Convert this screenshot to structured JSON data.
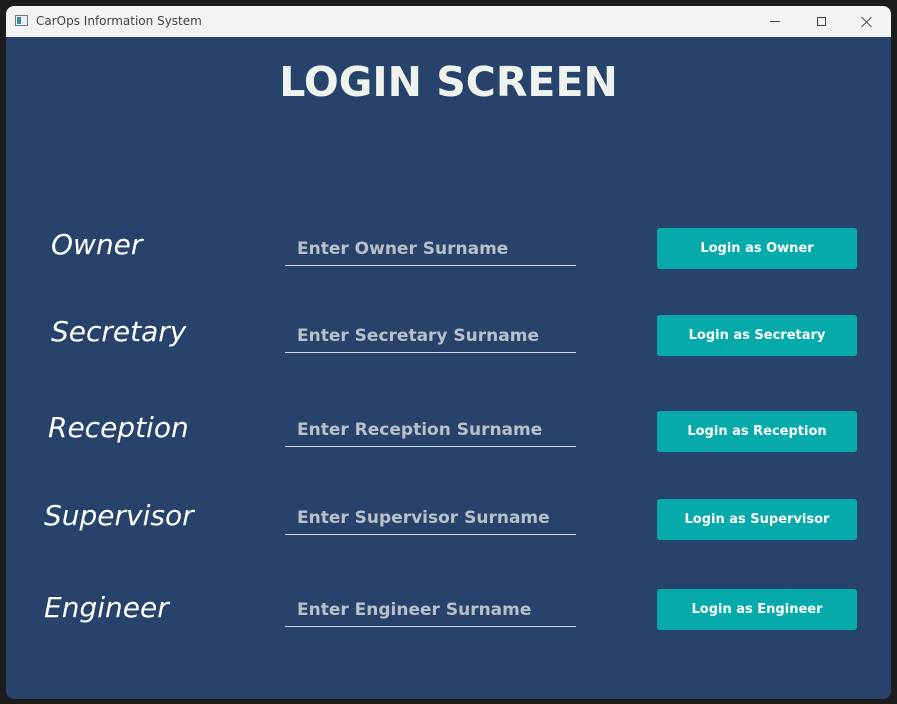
{
  "window": {
    "title": "CarOps Information System"
  },
  "heading": "LOGIN SCREEN",
  "roles": [
    {
      "label": "Owner",
      "placeholder": "Enter Owner Surname",
      "value": "",
      "button": "Login as Owner"
    },
    {
      "label": "Secretary",
      "placeholder": "Enter Secretary Surname",
      "value": "",
      "button": "Login as Secretary"
    },
    {
      "label": "Reception",
      "placeholder": "Enter Reception Surname",
      "value": "",
      "button": "Login as Reception"
    },
    {
      "label": "Supervisor",
      "placeholder": "Enter Supervisor Surname",
      "value": "",
      "button": "Login as Supervisor"
    },
    {
      "label": "Engineer",
      "placeholder": "Enter Engineer Surname",
      "value": "",
      "button": "Login as Engineer"
    }
  ],
  "colors": {
    "background": "#27426b",
    "button": "#06aaaa",
    "heading": "#eef3ee"
  }
}
